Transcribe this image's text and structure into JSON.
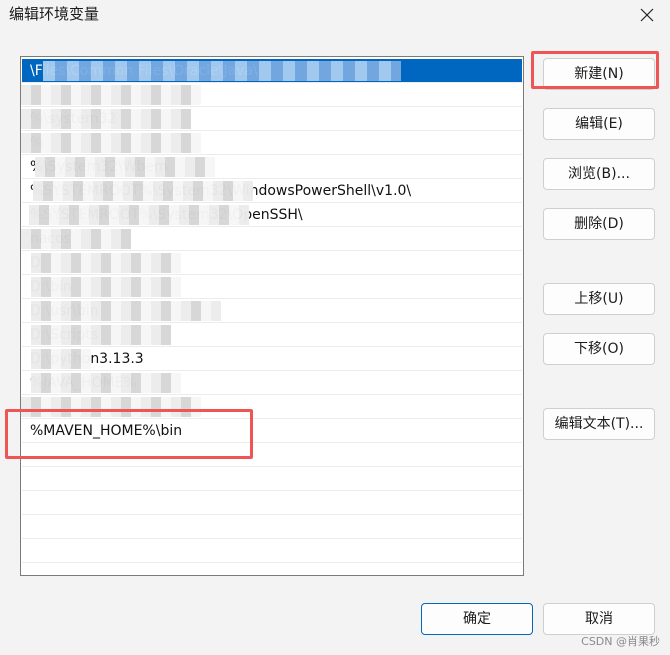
{
  "window": {
    "title": "编辑环境变量"
  },
  "path_list": {
    "rows": [
      "\\Files\\Common Files\\Oracle\\Java\\",
      "",
      "%\\system32",
      "%",
      "%\\System32\\Wbem",
      "%SYSTEMROOT%\\System32\\WindowsPowerShell\\v1.0\\",
      "%SYSTEMROOT%\\System32\\OpenSSH\\",
      "nacos",
      "D:",
      "D:\\bin",
      "D:\\usr\\bin",
      "D:\\Scripts",
      "D:\\python3.13.3",
      "%JAVA_HOME%",
      "",
      "%MAVEN_HOME%\\bin",
      "",
      "",
      "",
      "",
      "",
      ""
    ]
  },
  "buttons": {
    "new": "新建(N)",
    "edit": "编辑(E)",
    "browse": "浏览(B)...",
    "delete": "删除(D)",
    "move_up": "上移(U)",
    "move_down": "下移(O)",
    "edit_text": "编辑文本(T)...",
    "ok": "确定",
    "cancel": "取消"
  },
  "watermark": "CSDN @肖果秒",
  "colors": {
    "selection": "#0067c0",
    "highlight_box": "#f05555"
  }
}
